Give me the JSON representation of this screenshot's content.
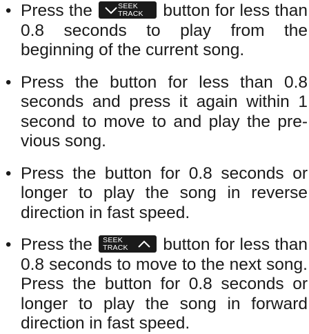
{
  "items": [
    {
      "pre": "Press the",
      "button": {
        "line1": "SEEK",
        "line2": "TRACK",
        "icon": "chevron-down-icon"
      },
      "post": "button for less than 0.8 seconds to play from the beginning of the current song."
    },
    {
      "text": "Press the button for less than 0.8 seconds and press it again within 1 second to move to and play the pre-vious song."
    },
    {
      "text": "Press the button for 0.8 seconds or longer to play the song in reverse direction in fast speed."
    },
    {
      "pre": "Press the",
      "button": {
        "line1": "SEEK",
        "line2": "TRACK",
        "icon": "chevron-up-icon"
      },
      "post": "button for less than 0.8 seconds to move to the next song. Press the button for 0.8 seconds or longer to play the song in forward direction in fast speed."
    }
  ],
  "bullet": "•"
}
